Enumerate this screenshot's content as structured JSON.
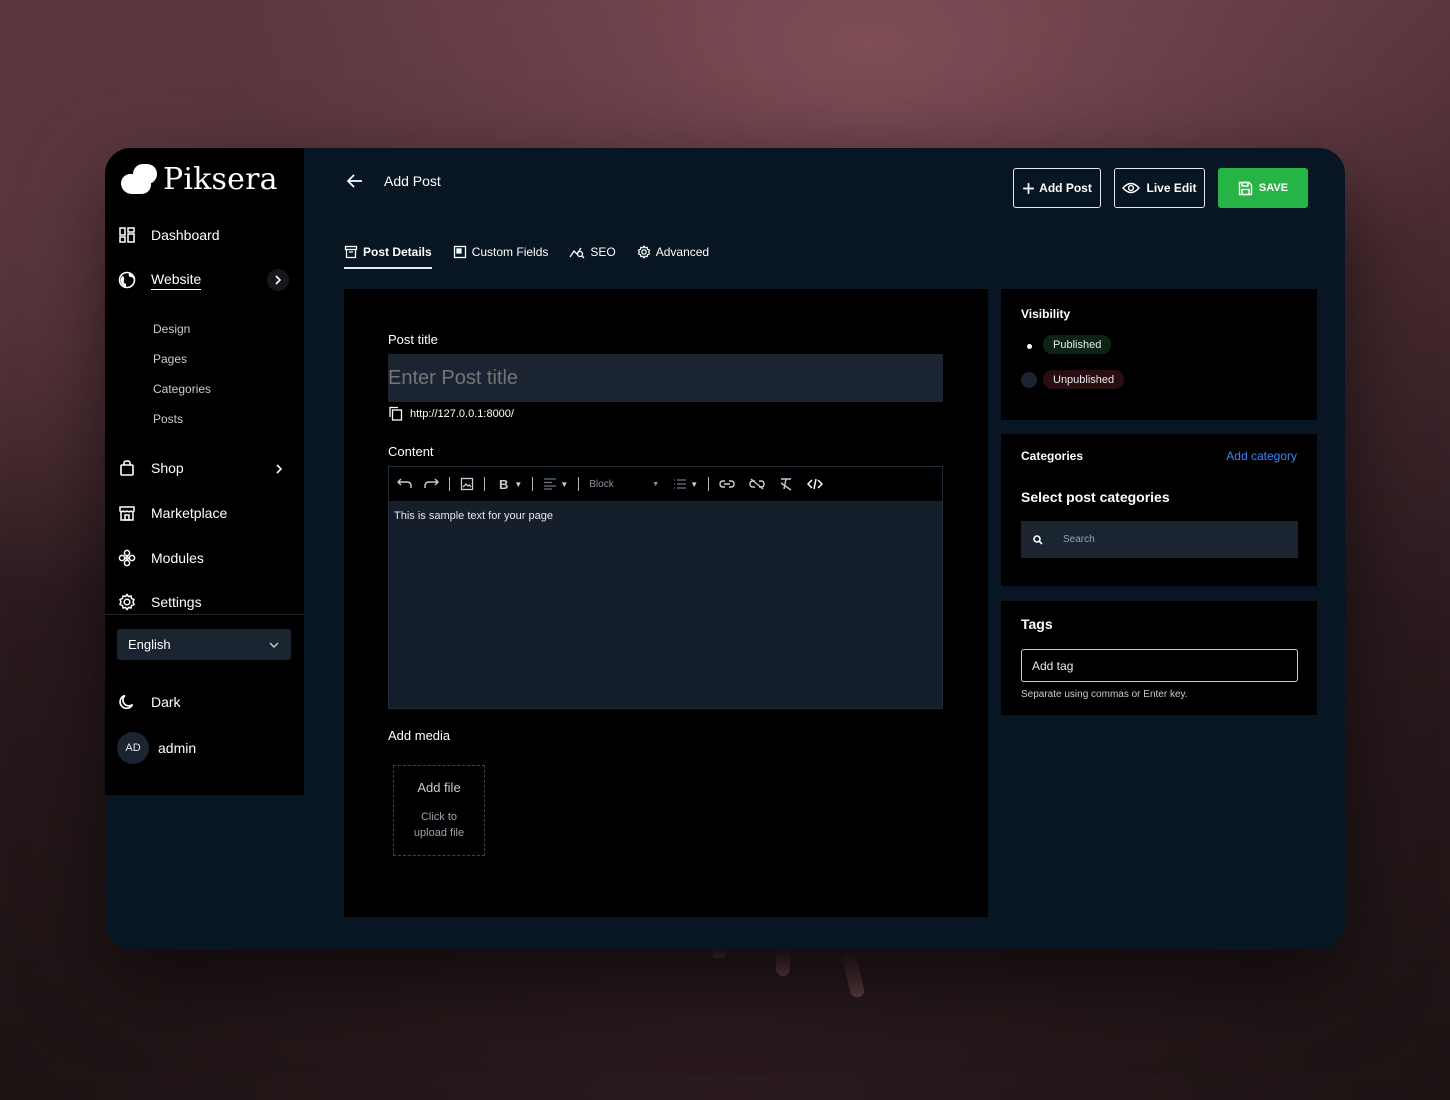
{
  "brand": {
    "name": "Piksera"
  },
  "sidebar": {
    "items": [
      {
        "label": "Dashboard"
      },
      {
        "label": "Website"
      },
      {
        "label": "Shop"
      },
      {
        "label": "Marketplace"
      },
      {
        "label": "Modules"
      },
      {
        "label": "Settings"
      }
    ],
    "website_sub": [
      "Design",
      "Pages",
      "Categories",
      "Posts"
    ],
    "language": "English",
    "theme": "Dark",
    "user": {
      "initials": "AD",
      "name": "admin"
    }
  },
  "header": {
    "title": "Add Post",
    "add_post_label": "Add Post",
    "live_edit_label": "Live Edit",
    "save_label": "SAVE"
  },
  "tabs": [
    {
      "label": "Post Details",
      "active": true
    },
    {
      "label": "Custom Fields"
    },
    {
      "label": "SEO"
    },
    {
      "label": "Advanced"
    }
  ],
  "form": {
    "title_label": "Post title",
    "title_placeholder": "Enter Post title",
    "url": "http://127.0.0.1:8000/",
    "content_label": "Content",
    "block_select": "Block",
    "content_text": "This is sample text for your page",
    "media_label": "Add media",
    "add_file": "Add file",
    "upload_hint": "Click to upload file"
  },
  "visibility": {
    "title": "Visibility",
    "published": "Published",
    "unpublished": "Unpublished"
  },
  "categories": {
    "title": "Categories",
    "add_link": "Add category",
    "subtitle": "Select post categories",
    "search_placeholder": "Search"
  },
  "tags": {
    "title": "Tags",
    "input_placeholder": "Add tag",
    "hint": "Separate using commas or Enter key."
  },
  "colors": {
    "accent_green": "#27b446",
    "link_blue": "#3b82f6",
    "panel": "#081522"
  }
}
